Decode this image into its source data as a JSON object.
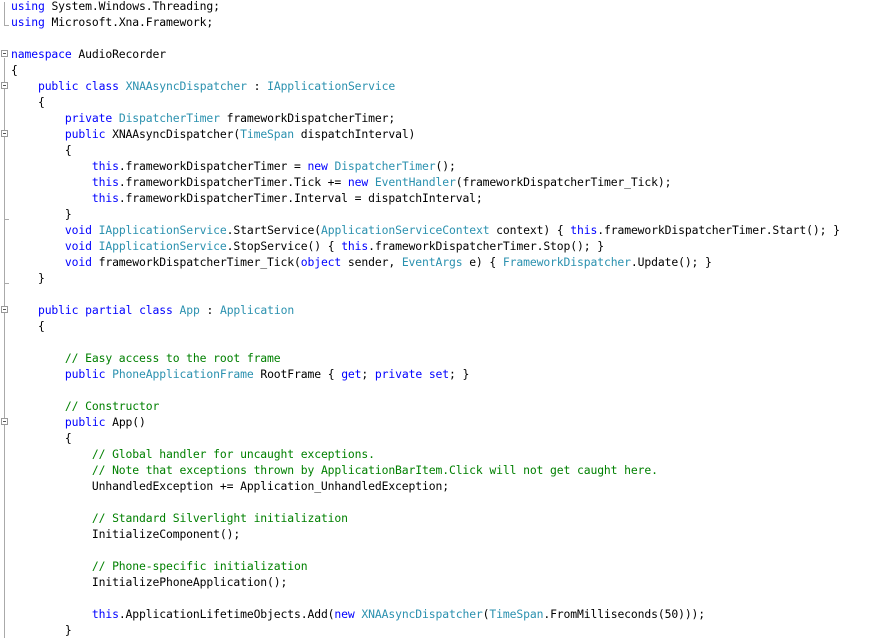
{
  "editor": {
    "language": "C#",
    "colors": {
      "keyword": "#0000ff",
      "type": "#2b91af",
      "comment": "#008000",
      "text": "#000000"
    },
    "lines": [
      [
        [
          "kw",
          "using"
        ],
        [
          "t",
          " System.Windows.Threading;"
        ]
      ],
      [
        [
          "kw",
          "using"
        ],
        [
          "t",
          " Microsoft.Xna.Framework;"
        ]
      ],
      [],
      [
        [
          "kw",
          "namespace"
        ],
        [
          "t",
          " AudioRecorder"
        ]
      ],
      [
        [
          "t",
          "{"
        ]
      ],
      [
        [
          "t",
          "    "
        ],
        [
          "kw",
          "public"
        ],
        [
          "t",
          " "
        ],
        [
          "kw",
          "class"
        ],
        [
          "t",
          " "
        ],
        [
          "ty",
          "XNAAsyncDispatcher"
        ],
        [
          "t",
          " : "
        ],
        [
          "ty",
          "IApplicationService"
        ]
      ],
      [
        [
          "t",
          "    {"
        ]
      ],
      [
        [
          "t",
          "        "
        ],
        [
          "kw",
          "private"
        ],
        [
          "t",
          " "
        ],
        [
          "ty",
          "DispatcherTimer"
        ],
        [
          "t",
          " frameworkDispatcherTimer;"
        ]
      ],
      [
        [
          "t",
          "        "
        ],
        [
          "kw",
          "public"
        ],
        [
          "t",
          " XNAAsyncDispatcher("
        ],
        [
          "ty",
          "TimeSpan"
        ],
        [
          "t",
          " dispatchInterval)"
        ]
      ],
      [
        [
          "t",
          "        {"
        ]
      ],
      [
        [
          "t",
          "            "
        ],
        [
          "kw",
          "this"
        ],
        [
          "t",
          ".frameworkDispatcherTimer = "
        ],
        [
          "kw",
          "new"
        ],
        [
          "t",
          " "
        ],
        [
          "ty",
          "DispatcherTimer"
        ],
        [
          "t",
          "();"
        ]
      ],
      [
        [
          "t",
          "            "
        ],
        [
          "kw",
          "this"
        ],
        [
          "t",
          ".frameworkDispatcherTimer.Tick += "
        ],
        [
          "kw",
          "new"
        ],
        [
          "t",
          " "
        ],
        [
          "ty",
          "EventHandler"
        ],
        [
          "t",
          "(frameworkDispatcherTimer_Tick);"
        ]
      ],
      [
        [
          "t",
          "            "
        ],
        [
          "kw",
          "this"
        ],
        [
          "t",
          ".frameworkDispatcherTimer.Interval = dispatchInterval;"
        ]
      ],
      [
        [
          "t",
          "        }"
        ]
      ],
      [
        [
          "t",
          "        "
        ],
        [
          "kw",
          "void"
        ],
        [
          "t",
          " "
        ],
        [
          "ty",
          "IApplicationService"
        ],
        [
          "t",
          ".StartService("
        ],
        [
          "ty",
          "ApplicationServiceContext"
        ],
        [
          "t",
          " context) { "
        ],
        [
          "kw",
          "this"
        ],
        [
          "t",
          ".frameworkDispatcherTimer.Start(); }"
        ]
      ],
      [
        [
          "t",
          "        "
        ],
        [
          "kw",
          "void"
        ],
        [
          "t",
          " "
        ],
        [
          "ty",
          "IApplicationService"
        ],
        [
          "t",
          ".StopService() { "
        ],
        [
          "kw",
          "this"
        ],
        [
          "t",
          ".frameworkDispatcherTimer.Stop(); }"
        ]
      ],
      [
        [
          "t",
          "        "
        ],
        [
          "kw",
          "void"
        ],
        [
          "t",
          " frameworkDispatcherTimer_Tick("
        ],
        [
          "kw",
          "object"
        ],
        [
          "t",
          " sender, "
        ],
        [
          "ty",
          "EventArgs"
        ],
        [
          "t",
          " e) { "
        ],
        [
          "ty",
          "FrameworkDispatcher"
        ],
        [
          "t",
          ".Update(); }"
        ]
      ],
      [
        [
          "t",
          "    }"
        ]
      ],
      [],
      [
        [
          "t",
          "    "
        ],
        [
          "kw",
          "public"
        ],
        [
          "t",
          " "
        ],
        [
          "kw",
          "partial"
        ],
        [
          "t",
          " "
        ],
        [
          "kw",
          "class"
        ],
        [
          "t",
          " "
        ],
        [
          "ty",
          "App"
        ],
        [
          "t",
          " : "
        ],
        [
          "ty",
          "Application"
        ]
      ],
      [
        [
          "t",
          "    {"
        ]
      ],
      [],
      [
        [
          "t",
          "        "
        ],
        [
          "cm",
          "// Easy access to the root frame"
        ]
      ],
      [
        [
          "t",
          "        "
        ],
        [
          "kw",
          "public"
        ],
        [
          "t",
          " "
        ],
        [
          "ty",
          "PhoneApplicationFrame"
        ],
        [
          "t",
          " RootFrame { "
        ],
        [
          "kw",
          "get"
        ],
        [
          "t",
          "; "
        ],
        [
          "kw",
          "private"
        ],
        [
          "t",
          " "
        ],
        [
          "kw",
          "set"
        ],
        [
          "t",
          "; }"
        ]
      ],
      [],
      [
        [
          "t",
          "        "
        ],
        [
          "cm",
          "// Constructor"
        ]
      ],
      [
        [
          "t",
          "        "
        ],
        [
          "kw",
          "public"
        ],
        [
          "t",
          " App()"
        ]
      ],
      [
        [
          "t",
          "        {"
        ]
      ],
      [
        [
          "t",
          "            "
        ],
        [
          "cm",
          "// Global handler for uncaught exceptions."
        ]
      ],
      [
        [
          "t",
          "            "
        ],
        [
          "cm",
          "// Note that exceptions thrown by ApplicationBarItem.Click will not get caught here."
        ]
      ],
      [
        [
          "t",
          "            UnhandledException += Application_UnhandledException;"
        ]
      ],
      [],
      [
        [
          "t",
          "            "
        ],
        [
          "cm",
          "// Standard Silverlight initialization"
        ]
      ],
      [
        [
          "t",
          "            InitializeComponent();"
        ]
      ],
      [],
      [
        [
          "t",
          "            "
        ],
        [
          "cm",
          "// Phone-specific initialization"
        ]
      ],
      [
        [
          "t",
          "            InitializePhoneApplication();"
        ]
      ],
      [],
      [
        [
          "t",
          "            "
        ],
        [
          "kw",
          "this"
        ],
        [
          "t",
          ".ApplicationLifetimeObjects.Add("
        ],
        [
          "kw",
          "new"
        ],
        [
          "t",
          " "
        ],
        [
          "ty",
          "XNAAsyncDispatcher"
        ],
        [
          "t",
          "("
        ],
        [
          "ty",
          "TimeSpan"
        ],
        [
          "t",
          ".FromMilliseconds(50)));"
        ]
      ],
      [
        [
          "t",
          "        }"
        ]
      ]
    ],
    "fold_lines": [
      3,
      5,
      8,
      19,
      26
    ]
  }
}
